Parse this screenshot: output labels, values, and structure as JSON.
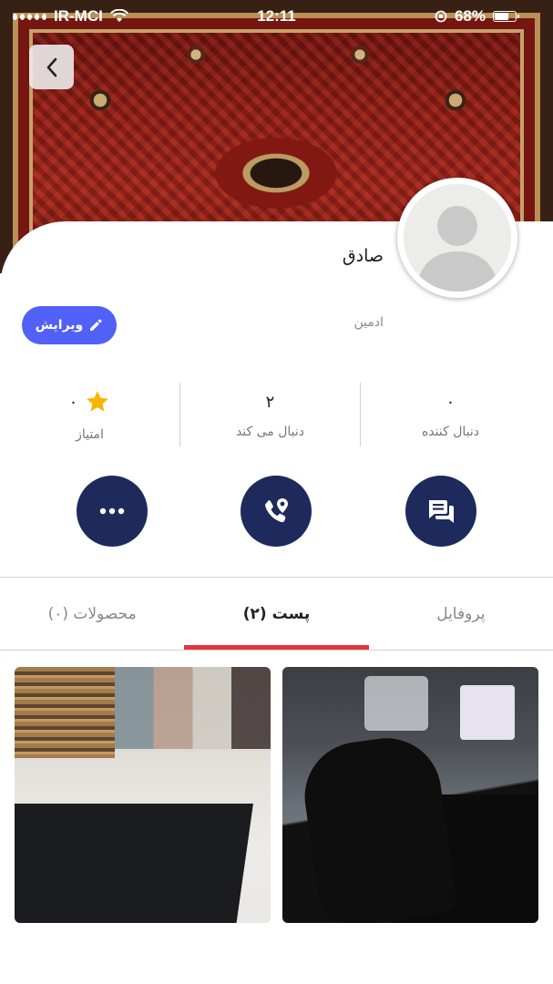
{
  "status_bar": {
    "carrier": "IR-MCI",
    "time": "12:11",
    "battery": "68%",
    "battery_level": 0.68
  },
  "header": {
    "back_icon": "chevron-left-icon"
  },
  "profile": {
    "name": "صادق",
    "role": "ادمین",
    "edit_label": "ویرایش",
    "edit_icon": "pencil-icon"
  },
  "stats": {
    "followers": {
      "value": "۰",
      "label": "دنبال کننده"
    },
    "following": {
      "value": "۲",
      "label": "دنبال می کند"
    },
    "rating": {
      "value": "۰",
      "label": "امتیاز",
      "icon": "star-icon"
    }
  },
  "actions": [
    {
      "name": "chat",
      "icon": "chat-icon"
    },
    {
      "name": "call",
      "icon": "phone-location-icon"
    },
    {
      "name": "more",
      "icon": "more-icon"
    }
  ],
  "tabs": [
    {
      "label": "پروفایل",
      "active": false
    },
    {
      "label": "پست (۲)",
      "active": true
    },
    {
      "label": "محصولات (۰)",
      "active": false
    }
  ],
  "colors": {
    "accent_blue": "#5160f6",
    "navy": "#1d2a5b",
    "tab_indicator": "#e8333d",
    "star": "#f7b500"
  }
}
